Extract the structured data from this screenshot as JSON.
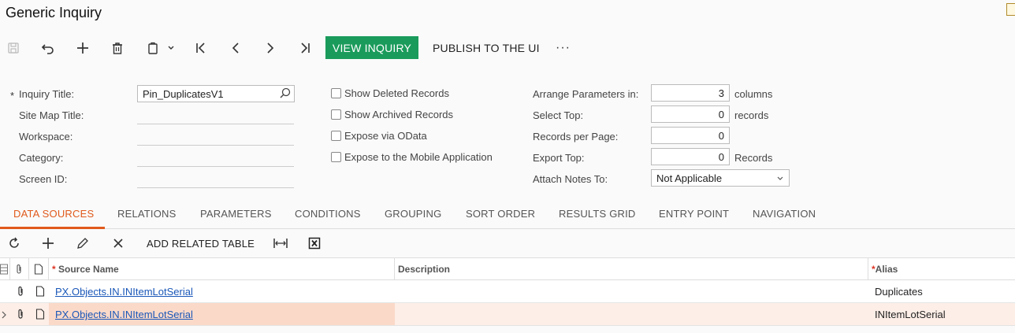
{
  "window": {
    "title": "Generic Inquiry"
  },
  "toolbar": {
    "view_inquiry": "VIEW INQUIRY",
    "publish": "PUBLISH TO THE UI",
    "more": "···"
  },
  "form": {
    "required_mark": "*",
    "inquiry_title": {
      "label": "Inquiry Title:",
      "value": "Pin_DuplicatesV1"
    },
    "site_map_title": {
      "label": "Site Map Title:"
    },
    "workspace": {
      "label": "Workspace:"
    },
    "category": {
      "label": "Category:"
    },
    "screen_id": {
      "label": "Screen ID:"
    },
    "checkboxes": [
      {
        "label": "Show Deleted Records",
        "checked": false
      },
      {
        "label": "Show Archived Records",
        "checked": false
      },
      {
        "label": "Expose via OData",
        "checked": false
      },
      {
        "label": "Expose to the Mobile Application",
        "checked": false
      }
    ],
    "arrange_params": {
      "label": "Arrange Parameters in:",
      "value": "3",
      "unit": "columns"
    },
    "select_top": {
      "label": "Select Top:",
      "value": "0",
      "unit": "records"
    },
    "records_per_page": {
      "label": "Records per Page:",
      "value": "0"
    },
    "export_top": {
      "label": "Export Top:",
      "value": "0",
      "unit": "Records"
    },
    "attach_notes": {
      "label": "Attach Notes To:",
      "value": "Not Applicable"
    }
  },
  "tabs": [
    "DATA SOURCES",
    "RELATIONS",
    "PARAMETERS",
    "CONDITIONS",
    "GROUPING",
    "SORT ORDER",
    "RESULTS GRID",
    "ENTRY POINT",
    "NAVIGATION"
  ],
  "grid_toolbar": {
    "add_related_table": "ADD RELATED TABLE"
  },
  "grid": {
    "columns": {
      "source_name": "Source Name",
      "description": "Description",
      "alias": "Alias",
      "required_mark": "*"
    },
    "rows": [
      {
        "source_name": "PX.Objects.IN.INItemLotSerial",
        "description": "",
        "alias": "Duplicates"
      },
      {
        "source_name": "PX.Objects.IN.INItemLotSerial",
        "description": "",
        "alias": "INItemLotSerial"
      }
    ]
  },
  "colors": {
    "accent": "#e05a1c",
    "primary_button": "#1a9b5b",
    "link": "#1a57b8",
    "selected_row": "#fde4d8"
  }
}
